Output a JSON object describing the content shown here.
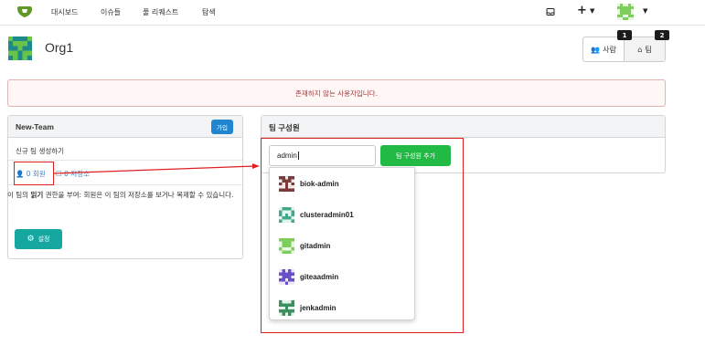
{
  "nav": {
    "items": [
      "대시보드",
      "이슈들",
      "풀 리퀘스트",
      "탐색"
    ],
    "plus": "+",
    "colors": {
      "logo": "#609926",
      "avatar": "#7ccf5a"
    }
  },
  "org": {
    "name": "Org1",
    "tabs": [
      {
        "label": "사람",
        "icon": "people-icon",
        "badge": "1"
      },
      {
        "label": "팀",
        "icon": "team-icon",
        "badge": "2"
      }
    ]
  },
  "alert": {
    "message": "존재하지 않는 사용자입니다."
  },
  "team": {
    "name": "New-Team",
    "join_label": "가입",
    "description": "신규 팀 생성하기",
    "members_count": "0",
    "members_label": "회원",
    "repos_count": "0",
    "repos_label": "저장소",
    "permission_text_pre": "이 팀의 ",
    "permission_bold": "읽기",
    "permission_text_post": " 권한을 부여: 회원은 이 팀의 저장소를 보거나 복제할 수 있습니다.",
    "settings_label": "설정"
  },
  "members_panel": {
    "title": "팀 구성원",
    "input_value": "admin",
    "add_button": "팀 구성원 추가",
    "suggestions": [
      {
        "name": "biok-admin",
        "color": "#7a3b3b"
      },
      {
        "name": "clusteradmin01",
        "color": "#3fa98a"
      },
      {
        "name": "gitadmin",
        "color": "#7ccf5a"
      },
      {
        "name": "giteaadmin",
        "color": "#6a4fc9"
      },
      {
        "name": "jenkadmin",
        "color": "#3c8f5e"
      }
    ]
  },
  "colors": {
    "accent_green": "#21ba45",
    "teal": "#17a7a1",
    "blue": "#2185d0",
    "error_bg": "#fff6f6",
    "error_text": "#9f3a38",
    "annotation_red": "#e02020"
  }
}
